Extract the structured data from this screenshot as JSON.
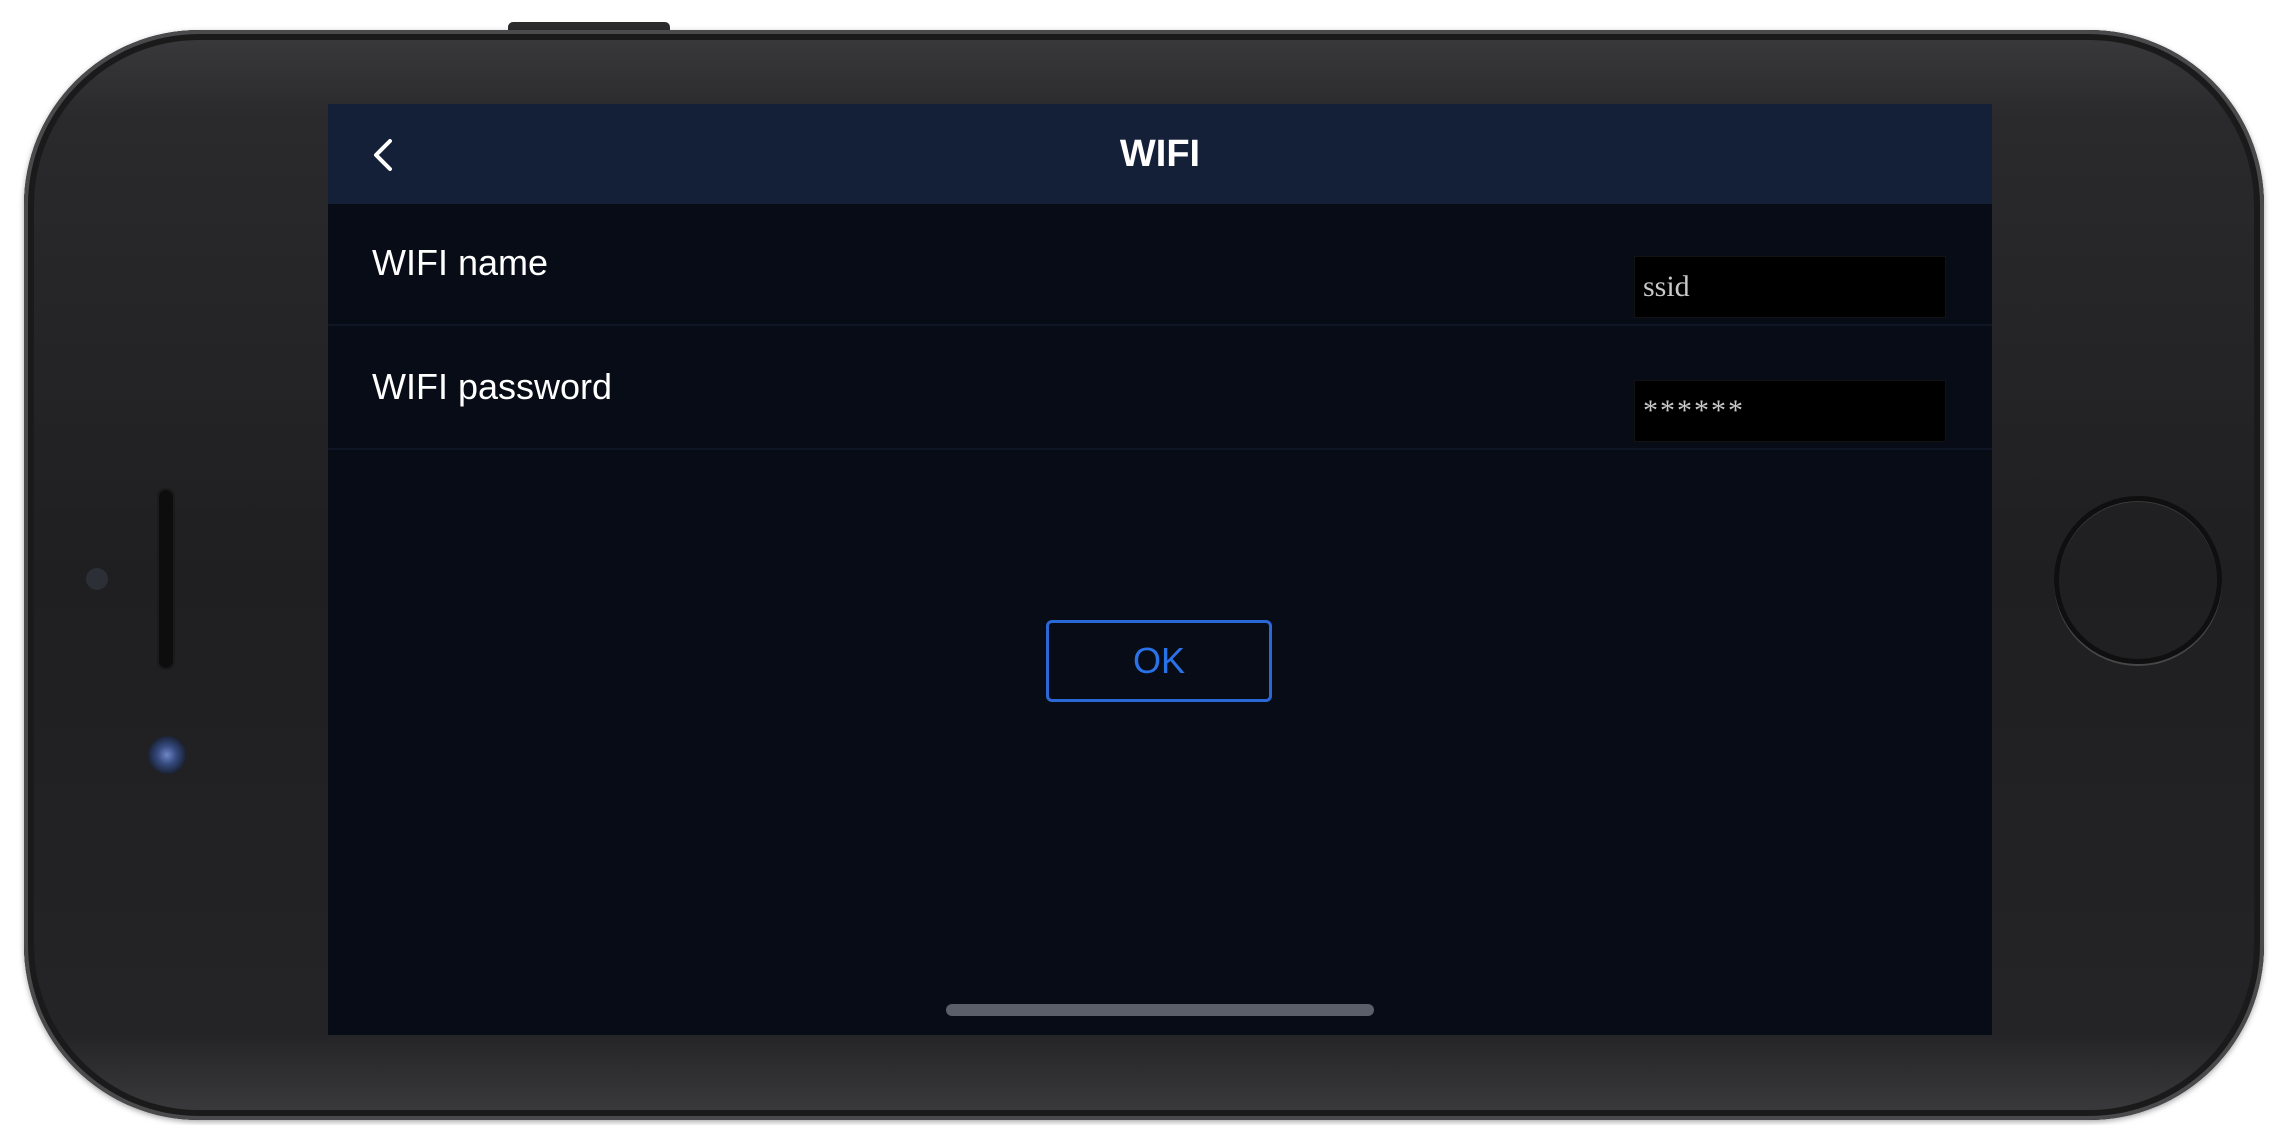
{
  "screen": {
    "title": "WIFI",
    "back_icon": "chevron-left-icon",
    "fields": [
      {
        "label": "WIFI name",
        "value": "ssid",
        "type": "text"
      },
      {
        "label": "WIFI password",
        "value": "******",
        "type": "password"
      }
    ],
    "ok_label": "OK"
  },
  "colors": {
    "nav_bar": "#142038",
    "background": "#080c16",
    "accent": "#2a72e8",
    "input_bg": "#000000",
    "text": "#ffffff"
  }
}
